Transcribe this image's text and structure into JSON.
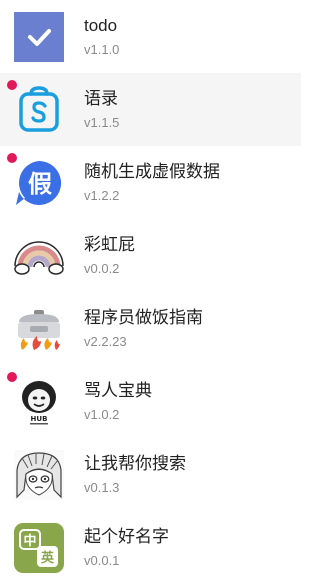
{
  "apps": [
    {
      "name": "todo",
      "version": "v1.1.0",
      "icon": "checkmark-icon",
      "unread": false,
      "active": false
    },
    {
      "name": "语录",
      "version": "v1.1.5",
      "icon": "quote-bag-icon",
      "unread": true,
      "active": true
    },
    {
      "name": "随机生成虚假数据",
      "version": "v1.2.2",
      "icon": "fake-data-icon",
      "icon_char": "假",
      "unread": true,
      "active": false
    },
    {
      "name": "彩虹屁",
      "version": "v0.0.2",
      "icon": "rainbow-icon",
      "unread": false,
      "active": false
    },
    {
      "name": "程序员做饭指南",
      "version": "v2.2.23",
      "icon": "rice-cooker-icon",
      "unread": false,
      "active": false
    },
    {
      "name": "骂人宝典",
      "version": "v1.0.2",
      "icon": "meme-face-icon",
      "icon_text": "HUB",
      "unread": true,
      "active": false
    },
    {
      "name": "让我帮你搜索",
      "version": "v0.1.3",
      "icon": "anime-face-icon",
      "unread": false,
      "active": false
    },
    {
      "name": "起个好名字",
      "version": "v0.0.1",
      "icon": "name-chars-icon",
      "icon_chars": [
        "中",
        "英"
      ],
      "unread": false,
      "active": false
    }
  ],
  "colors": {
    "todo": "#6b7fd1",
    "quote": "#1a9ee0",
    "fake": "#3b6fe6",
    "unread_dot": "#e0195b",
    "name_tile": "#8aa64a"
  }
}
